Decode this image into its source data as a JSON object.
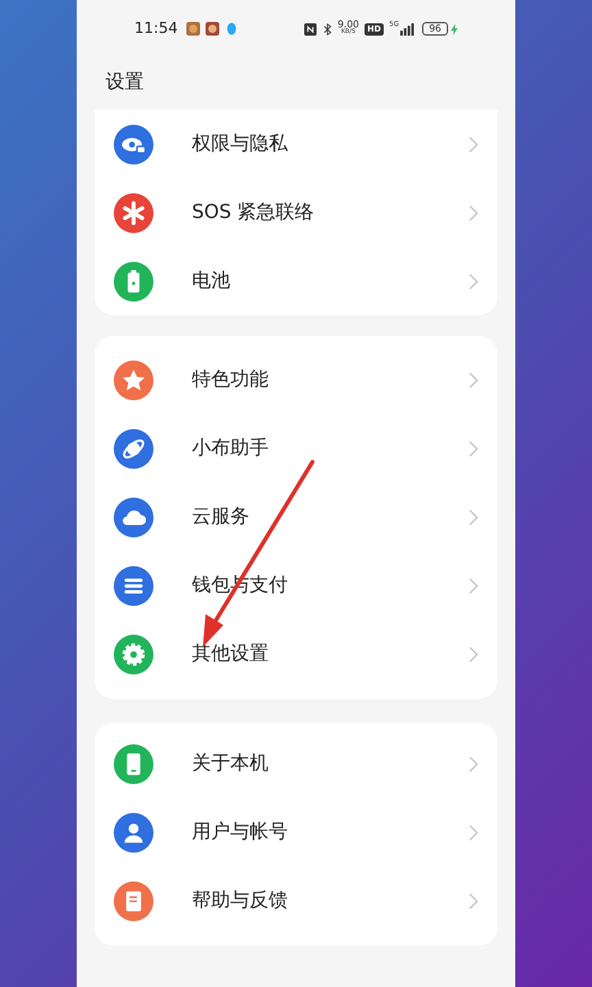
{
  "status_bar": {
    "time": "11:54",
    "speed": "9.00",
    "speed_unit": "KB/S",
    "hd": "HD",
    "network": "5G",
    "battery": "96"
  },
  "header": {
    "title": "设置"
  },
  "groups": [
    {
      "items": [
        {
          "label": "权限与隐私",
          "color": "#2f6fe0"
        },
        {
          "label": "SOS 紧急联络",
          "color": "#e8443a"
        },
        {
          "label": "电池",
          "color": "#22b45a"
        }
      ]
    },
    {
      "items": [
        {
          "label": "特色功能",
          "color": "#f0704a"
        },
        {
          "label": "小布助手",
          "color": "#2f6fe0"
        },
        {
          "label": "云服务",
          "color": "#2f6fe0"
        },
        {
          "label": "钱包与支付",
          "color": "#2f6fe0"
        },
        {
          "label": "其他设置",
          "color": "#22b45a"
        }
      ]
    },
    {
      "items": [
        {
          "label": "关于本机",
          "color": "#22b45a"
        },
        {
          "label": "用户与帐号",
          "color": "#2f6fe0"
        },
        {
          "label": "帮助与反馈",
          "color": "#f0704a"
        }
      ]
    }
  ]
}
